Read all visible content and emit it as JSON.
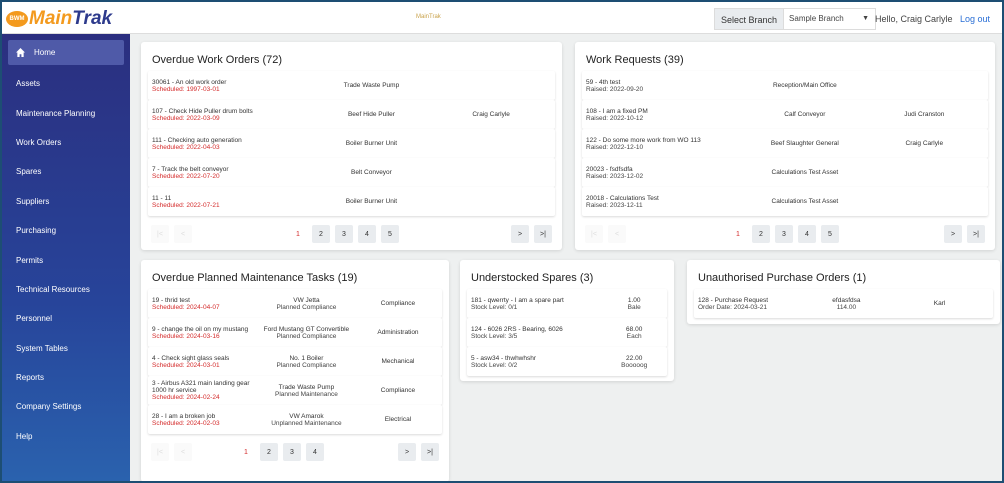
{
  "header": {
    "logo_badge": "BWM",
    "logo_main": "Main",
    "logo_trak": "Trak",
    "mid_logo": "MainTrak",
    "branch_label": "Select Branch",
    "branch_value": "Sample Branch",
    "greeting": "Hello, Craig Carlyle",
    "logout": "Log out"
  },
  "sidebar": {
    "items": [
      "Home",
      "Assets",
      "Maintenance Planning",
      "Work Orders",
      "Spares",
      "Suppliers",
      "Purchasing",
      "Permits",
      "Technical Resources",
      "Personnel",
      "System Tables",
      "Reports",
      "Company Settings",
      "Help"
    ]
  },
  "overdue_work_orders": {
    "title": "Overdue Work Orders (72)",
    "rows": [
      {
        "a": "30061 - An old work order",
        "b": "Scheduled: 1997-03-01",
        "c": "Trade Waste Pump",
        "d": ""
      },
      {
        "a": "107 - Check Hide Puller drum bolts",
        "b": "Scheduled: 2022-03-09",
        "c": "Beef Hide Puller",
        "d": "Craig Carlyle"
      },
      {
        "a": "111 - Checking auto generation",
        "b": "Scheduled: 2022-04-03",
        "c": "Boiler Burner Unit",
        "d": ""
      },
      {
        "a": "7 - Track the belt conveyor",
        "b": "Scheduled: 2022-07-20",
        "c": "Belt Conveyor",
        "d": ""
      },
      {
        "a": "11 - 11",
        "b": "Scheduled: 2022-07-21",
        "c": "Boiler Burner Unit",
        "d": ""
      }
    ],
    "pages": [
      "1",
      "2",
      "3",
      "4",
      "5"
    ]
  },
  "work_requests": {
    "title": "Work Requests (39)",
    "rows": [
      {
        "a": "59 - 4th test",
        "b": "Raised: 2022-09-20",
        "c": "Reception/Main Office",
        "d": ""
      },
      {
        "a": "108 - I am a fixed PM",
        "b": "Raised: 2022-10-12",
        "c": "Calf Conveyor",
        "d": "Judi Cranston"
      },
      {
        "a": "122 - Do some more work from WO 113",
        "b": "Raised: 2022-12-10",
        "c": "Beef Slaughter General",
        "d": "Craig Carlyle"
      },
      {
        "a": "20023 - fsdfsdfa",
        "b": "Raised: 2023-12-02",
        "c": "Calculations Test Asset",
        "d": ""
      },
      {
        "a": "20018 - Calculations Test",
        "b": "Raised: 2023-12-11",
        "c": "Calculations Test Asset",
        "d": ""
      }
    ],
    "pages": [
      "1",
      "2",
      "3",
      "4",
      "5"
    ]
  },
  "overdue_pm_tasks": {
    "title": "Overdue Planned Maintenance Tasks (19)",
    "rows": [
      {
        "a": "19 - thrid test",
        "b": "Scheduled: 2024-04-07",
        "c": "VW Jetta",
        "e": "Planned Compliance",
        "d": "Compliance"
      },
      {
        "a": "9 - change the oil on my mustang",
        "b": "Scheduled: 2024-03-16",
        "c": "Ford Mustang GT Convertible",
        "e": "Planned Compliance",
        "d": "Administration"
      },
      {
        "a": "4 - Check sight glass seals",
        "b": "Scheduled: 2024-03-01",
        "c": "No. 1 Boiler",
        "e": "Planned Compliance",
        "d": "Mechanical"
      },
      {
        "a": "3 - Airbus A321 main landing gear 1000 hr service",
        "b": "Scheduled: 2024-02-24",
        "c": "Trade Waste Pump",
        "e": "Planned Maintenance",
        "d": "Compliance"
      },
      {
        "a": "28 - I am a broken job",
        "b": "Scheduled: 2024-02-03",
        "c": "VW Amarok",
        "e": "Unplanned Maintenance",
        "d": "Electrical"
      }
    ],
    "pages": [
      "1",
      "2",
      "3",
      "4"
    ]
  },
  "understocked_spares": {
    "title": "Understocked Spares (3)",
    "rows": [
      {
        "a": "181 - qwerrty - I am a spare part",
        "b": "Stock Level: 0/1",
        "c": "1.00",
        "e": "Bale"
      },
      {
        "a": "124 - 6026 2RS - Bearing, 6026",
        "b": "Stock Level: 3/5",
        "c": "68.00",
        "e": "Each"
      },
      {
        "a": "5 - asw34 - thwhwhshr",
        "b": "Stock Level: 0/2",
        "c": "22.00",
        "e": "Booooog"
      }
    ]
  },
  "unauthorised_pos": {
    "title": "Unauthorised Purchase Orders (1)",
    "rows": [
      {
        "a": "128 - Purchase Request",
        "b": "Order Date: 2024-03-21",
        "c": "efdasfdsa",
        "e": "114.00",
        "d": "Karl"
      }
    ]
  },
  "pager_icons": {
    "first": "|<",
    "prev": "<",
    "next": ">",
    "last": ">|"
  }
}
